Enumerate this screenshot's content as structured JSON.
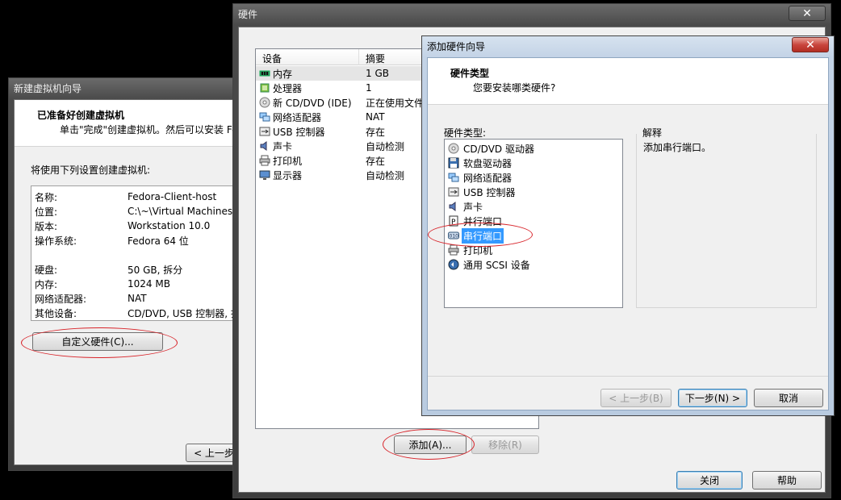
{
  "window1": {
    "title": "新建虚拟机向导",
    "header_title": "已准备好创建虚拟机",
    "header_sub": "单击\"完成\"创建虚拟机。然后可以安装 Fe",
    "intro": "将使用下列设置创建虚拟机:",
    "summary": [
      {
        "k": "名称:",
        "v": "Fedora-Client-host"
      },
      {
        "k": "位置:",
        "v": "C:\\~\\Virtual Machines\\Fe"
      },
      {
        "k": "版本:",
        "v": "Workstation 10.0"
      },
      {
        "k": "操作系统:",
        "v": "Fedora 64 位"
      },
      {
        "k": "",
        "v": ""
      },
      {
        "k": "硬盘:",
        "v": "50 GB, 拆分"
      },
      {
        "k": "内存:",
        "v": "1024 MB"
      },
      {
        "k": "网络适配器:",
        "v": "NAT"
      },
      {
        "k": "其他设备:",
        "v": "CD/DVD, USB 控制器, 打"
      }
    ],
    "customize_button": "自定义硬件(C)...",
    "back_button": "< 上一步"
  },
  "window2": {
    "title": "硬件",
    "col_device": "设备",
    "col_summary": "摘要",
    "devices": [
      {
        "name": "内存",
        "summary": "1 GB",
        "icon": "memory-icon"
      },
      {
        "name": "处理器",
        "summary": "1",
        "icon": "cpu-icon"
      },
      {
        "name": "新 CD/DVD (IDE)",
        "summary": "正在使用文件",
        "icon": "cd-icon"
      },
      {
        "name": "网络适配器",
        "summary": "NAT",
        "icon": "network-icon"
      },
      {
        "name": "USB 控制器",
        "summary": "存在",
        "icon": "usb-icon"
      },
      {
        "name": "声卡",
        "summary": "自动检测",
        "icon": "sound-icon"
      },
      {
        "name": "打印机",
        "summary": "存在",
        "icon": "printer-icon"
      },
      {
        "name": "显示器",
        "summary": "自动检测",
        "icon": "display-icon"
      }
    ],
    "add_button": "添加(A)...",
    "remove_button": "移除(R)",
    "close_button": "关闭",
    "help_button": "帮助",
    "col_3": "设备"
  },
  "window3": {
    "title": "添加硬件向导",
    "header_title": "硬件类型",
    "header_sub": "您要安装哪类硬件?",
    "list_label": "硬件类型:",
    "hardware": [
      {
        "name": "CD/DVD 驱动器",
        "icon": "cd-icon"
      },
      {
        "name": "软盘驱动器",
        "icon": "floppy-icon"
      },
      {
        "name": "网络适配器",
        "icon": "network-icon"
      },
      {
        "name": "USB 控制器",
        "icon": "usb-icon"
      },
      {
        "name": "声卡",
        "icon": "sound-icon"
      },
      {
        "name": "并行端口",
        "icon": "parallel-port-icon"
      },
      {
        "name": "串行端口",
        "icon": "serial-port-icon",
        "selected": true
      },
      {
        "name": "打印机",
        "icon": "printer-icon"
      },
      {
        "name": "通用 SCSI 设备",
        "icon": "scsi-icon"
      }
    ],
    "explain_label": "解释",
    "explain_text": "添加串行端口。",
    "back_button": "< 上一步(B)",
    "next_button": "下一步(N) >",
    "cancel_button": "取消"
  },
  "colors": {
    "selection": "#3399ff",
    "highlight_oval": "#d8242a",
    "close_red": "#c9463d"
  }
}
